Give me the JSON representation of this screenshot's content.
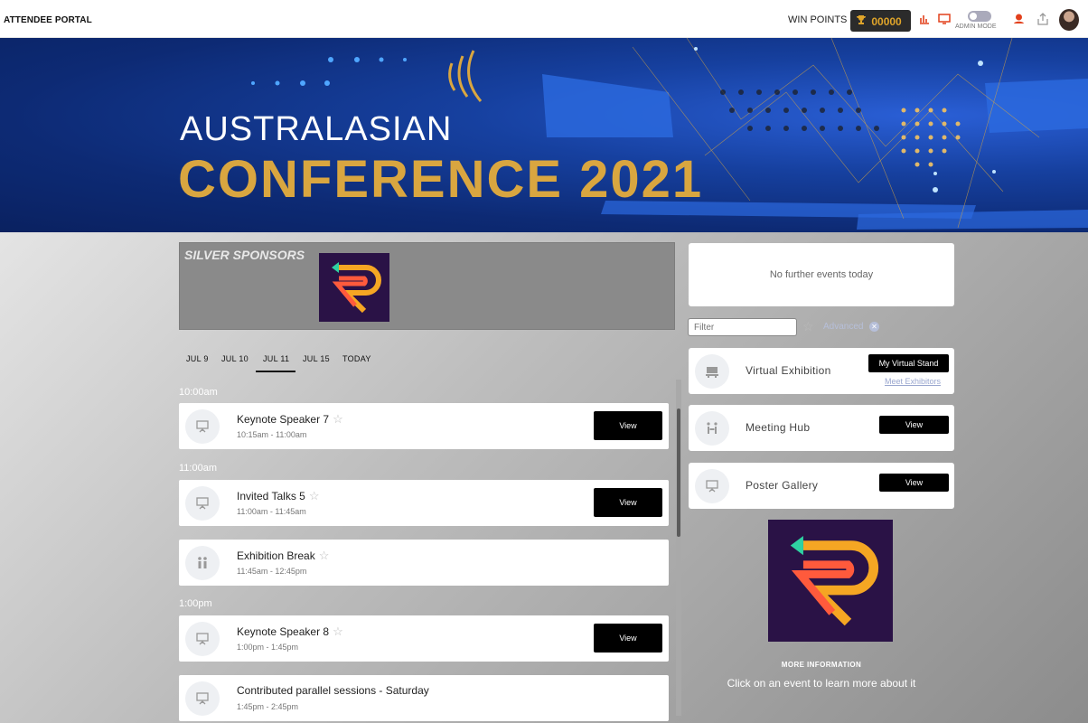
{
  "topbar": {
    "portal_title": "ATTENDEE PORTAL",
    "win_points_label": "WIN POINTS",
    "points_value": "00000",
    "admin_mode_label": "ADMIN MODE"
  },
  "banner": {
    "line1": "AUSTRALASIAN",
    "line2": "CONFERENCE 2021"
  },
  "sponsors": {
    "title": "SILVER SPONSORS"
  },
  "date_tabs": [
    {
      "label": "JUL 9",
      "selected": false
    },
    {
      "label": "JUL 10",
      "selected": false
    },
    {
      "label": "JUL 11",
      "selected": true
    },
    {
      "label": "JUL 15",
      "selected": false
    },
    {
      "label": "TODAY",
      "selected": false
    }
  ],
  "schedule": {
    "time_slots": [
      "10:00am",
      "11:00am",
      "1:00pm"
    ],
    "events": [
      {
        "title": "Keynote Speaker 7",
        "time": "10:15am - 11:00am",
        "button": "View"
      },
      {
        "title": "Invited Talks 5",
        "time": "11:00am - 11:45am",
        "button": "View"
      },
      {
        "title": "Exhibition Break",
        "time": "11:45am - 12:45pm"
      },
      {
        "title": "Keynote Speaker 8",
        "time": "1:00pm - 1:45pm",
        "button": "View"
      },
      {
        "title": "Contributed parallel sessions - Saturday",
        "time": "1:45pm - 2:45pm"
      }
    ]
  },
  "right_panel": {
    "no_events_text": "No further events today",
    "filter_placeholder": "Filter",
    "advanced_label": "Advanced",
    "cards": [
      {
        "label": "Virtual Exhibition",
        "button": "My Virtual Stand",
        "link": "Meet Exhibitors"
      },
      {
        "label": "Meeting Hub",
        "button": "View"
      },
      {
        "label": "Poster Gallery",
        "button": "View"
      }
    ],
    "more_info_title": "MORE INFORMATION",
    "more_info_text": "Click on an event to learn more about it"
  },
  "colors": {
    "accent_gold": "#d9a640",
    "banner_blue": "#16409f",
    "button_black": "#000000",
    "icon_red": "#e2401c"
  },
  "icons": [
    "trophy-icon",
    "chart-icon",
    "monitor-icon",
    "support-icon",
    "share-icon",
    "presentation-icon",
    "people-icon",
    "exhibition-icon",
    "meeting-icon",
    "star-icon"
  ]
}
